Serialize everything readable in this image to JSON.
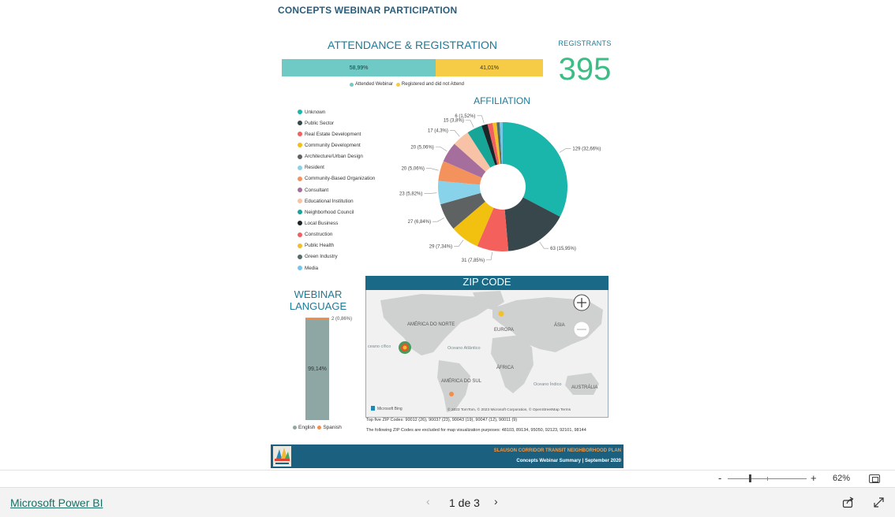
{
  "report": {
    "title": "CONCEPTS WEBINAR PARTICIPATION"
  },
  "attendance": {
    "title": "ATTENDANCE & REGISTRATION",
    "segments": [
      {
        "label": "Attended Webinar",
        "value_label": "58,99%",
        "pct": 58.99,
        "color": "#6fcac5"
      },
      {
        "label": "Registered and did not Attend",
        "value_label": "41,01%",
        "pct": 41.01,
        "color": "#f6cb45"
      }
    ]
  },
  "registrants": {
    "title": "REGISTRANTS",
    "value": "395"
  },
  "affiliation": {
    "title": "AFFILIATION",
    "legend": [
      {
        "label": "Unknown",
        "color": "#1ab5ab"
      },
      {
        "label": "Public Sector",
        "color": "#37474b"
      },
      {
        "label": "Real Estate Development",
        "color": "#f4605c"
      },
      {
        "label": "Community Development",
        "color": "#f2c10f"
      },
      {
        "label": "Architecture/Urban Design",
        "color": "#5f6262"
      },
      {
        "label": "Resident",
        "color": "#88d3ea"
      },
      {
        "label": "Community-Based Organization",
        "color": "#f4925e"
      },
      {
        "label": "Consultant",
        "color": "#a56e9c"
      },
      {
        "label": "Educational Institution",
        "color": "#f8c2a6"
      },
      {
        "label": "Neighborhood Council",
        "color": "#16a596"
      },
      {
        "label": "Local Business",
        "color": "#1b2427"
      },
      {
        "label": "Construction",
        "color": "#f06060"
      },
      {
        "label": "Public Health",
        "color": "#f3bd2b"
      },
      {
        "label": "Green Industry",
        "color": "#556b69"
      },
      {
        "label": "Media",
        "color": "#71c8e8"
      }
    ]
  },
  "chart_data": {
    "type": "pie",
    "title": "AFFILIATION",
    "categories": [
      "Unknown",
      "Public Sector",
      "Real Estate Development",
      "Community Development",
      "Architecture/Urban Design",
      "Resident",
      "Community-Based Organization",
      "Consultant",
      "Educational Institution",
      "Neighborhood Council",
      "Local Business",
      "Construction",
      "Public Health",
      "Green Industry",
      "Media"
    ],
    "values": [
      129,
      63,
      31,
      29,
      27,
      23,
      20,
      20,
      17,
      15,
      6,
      5,
      4,
      3,
      3
    ],
    "data_labels": [
      "129 (32,66%)",
      "63 (15,95%)",
      "31 (7,85%)",
      "29 (7,34%)",
      "27 (6,84%)",
      "23 (5,82%)",
      "20 (5,06%)",
      "20 (5,06%)",
      "17 (4,3%)",
      "15 (3,8%)",
      "6 (1,52%)",
      "",
      "",
      "",
      ""
    ],
    "donut": true
  },
  "language": {
    "title_line1": "WEBINAR",
    "title_line2": "LANGUAGE",
    "english_pct_label": "99,14%",
    "spanish_label": "2 (0,86%)",
    "english_pct": 99.14,
    "legend": [
      {
        "label": "English",
        "color": "#8ea7a5"
      },
      {
        "label": "Spanish",
        "color": "#f58c4b"
      }
    ]
  },
  "map": {
    "title": "ZIP CODE",
    "labels": {
      "north_america": "AMÉRICA DO NORTE",
      "south_america": "AMÉRICA DO SUL",
      "europe": "EUROPA",
      "asia": "ÁSIA",
      "africa": "ÁFRICA",
      "australia": "AUSTRÁLIA",
      "atlantic": "Oceano Atlântico",
      "indian": "Oceano Índico",
      "pacific": "ceano cífico"
    },
    "brand": "Microsoft Bing",
    "attribution": "© 2023 TomTom, © 2023 Microsoft Corporation, © OpenStreetMap  Terms",
    "note1": "Top five ZIP Codes: 90012 (26), 90037 (23), 90043 (19), 90047 (12), 90011 (9)",
    "note2": "The following ZIP Codes are excluded for map visualization purposes: 48103, 89134, 95050, 92123, 92101, 98144"
  },
  "footer": {
    "plan_title": "SLAUSON CORRIDOR TRANSIT NEIGHBORHOOD PLAN",
    "subtitle": "Concepts Webinar Summary | September 2020"
  },
  "viewer": {
    "zoom_label": "62%",
    "brand_link": "Microsoft Power BI",
    "page_indicator": "1 de 3",
    "zoom_minus": "-",
    "zoom_plus": "+"
  }
}
